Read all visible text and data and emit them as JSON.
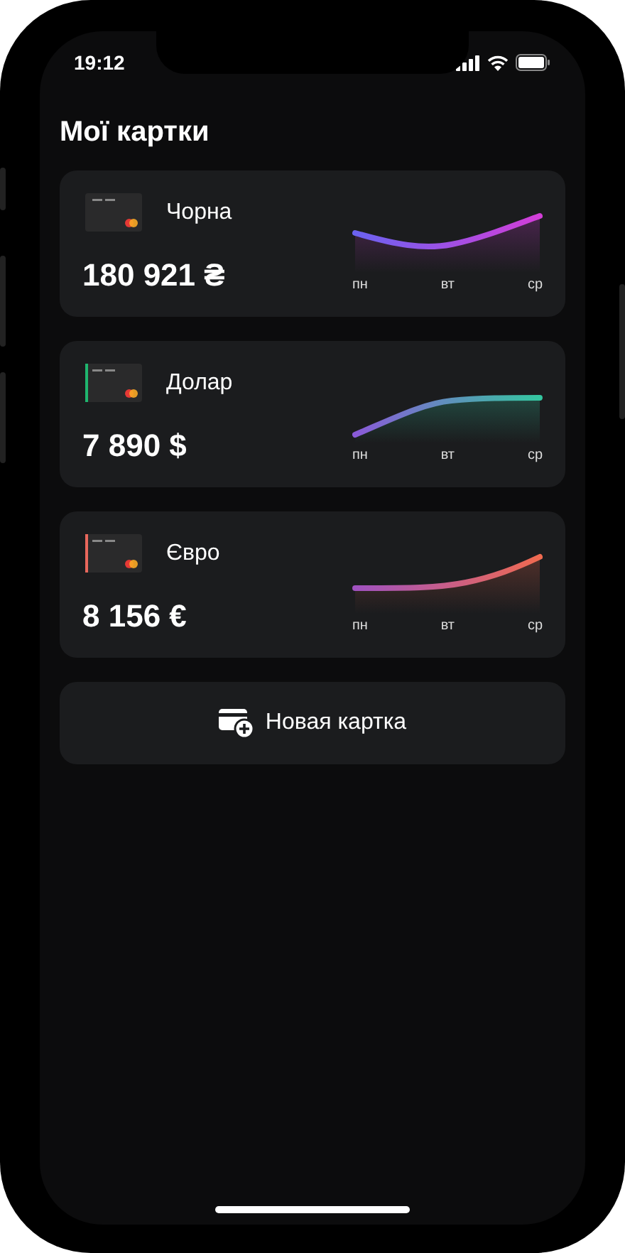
{
  "status_bar": {
    "time": "19:12"
  },
  "title": "Мої картки",
  "cards": [
    {
      "name": "Чорна",
      "amount": "180 921 ₴",
      "kind": "dip",
      "days": [
        "пн",
        "вт",
        "ср"
      ]
    },
    {
      "name": "Долар",
      "amount": "7 890 $",
      "kind": "plateau",
      "color": "#1fb56e",
      "days": [
        "пн",
        "вт",
        "ср"
      ]
    },
    {
      "name": "Євро",
      "amount": "8 156 €",
      "kind": "rise",
      "color": "#e8675c",
      "days": [
        "пн",
        "вт",
        "ср"
      ]
    }
  ],
  "new_card_button": "Новая картка"
}
